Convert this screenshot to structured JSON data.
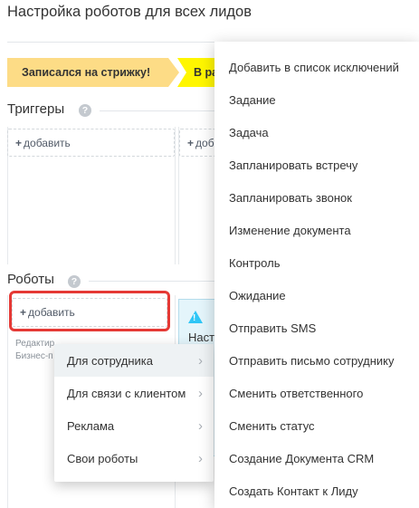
{
  "page": {
    "title": "Настройка роботов для всех лидов"
  },
  "stages": [
    {
      "label": "Записался на стрижку!",
      "color": "#fddc86"
    },
    {
      "label": "В ра",
      "color": "#fff600"
    },
    {
      "label": "",
      "color": "#ea3b3b"
    }
  ],
  "triggers": {
    "title": "Триггеры",
    "help": "?",
    "columns": [
      {
        "add_label": "добавить"
      },
      {
        "add_label": "доб"
      }
    ]
  },
  "robots": {
    "title": "Роботы",
    "help": "?",
    "add_label": "добавить",
    "card_text": "Наст",
    "card_sub": "с",
    "hint_lines": [
      "Редактир",
      "Бизнес-п"
    ],
    "right_edge_hint": [
      "Реда",
      "Бизн"
    ]
  },
  "robot_submenu": {
    "items": [
      {
        "label": "Для сотрудника",
        "active": true
      },
      {
        "label": "Для связи с клиентом",
        "active": false
      },
      {
        "label": "Реклама",
        "active": false
      },
      {
        "label": "Свои роботы",
        "active": false
      }
    ]
  },
  "robot_list_menu": {
    "items": [
      "Добавить в список исключений",
      "Задание",
      "Задача",
      "Запланировать встречу",
      "Запланировать звонок",
      "Изменение документа",
      "Контроль",
      "Ожидание",
      "Отправить SMS",
      "Отправить письмо сотруднику",
      "Сменить ответственного",
      "Сменить статус",
      "Создание Документа CRM",
      "Создать Контакт к Лиду"
    ]
  },
  "icons": {
    "plus": "+",
    "chevron": "›",
    "warning": "!"
  },
  "colors": {
    "highlight": "#e53935",
    "info_card": "#e4f5fb",
    "info_icon": "#2fc6f6"
  }
}
